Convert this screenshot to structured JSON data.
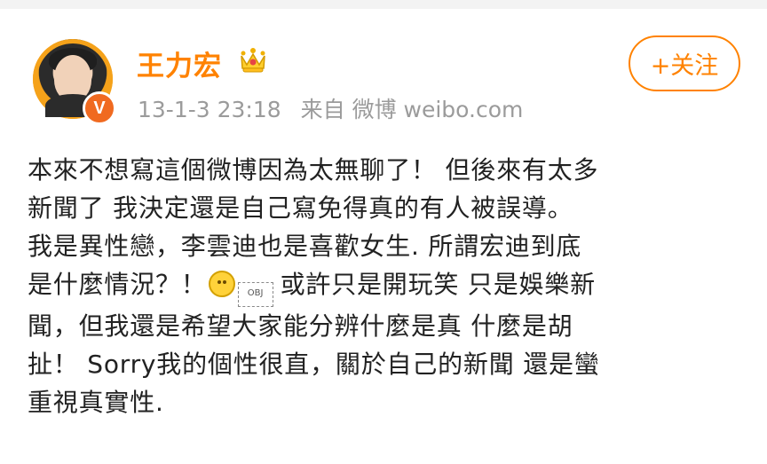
{
  "profile": {
    "username": "王力宏",
    "avatar_icon": "avatar-icon",
    "verified_badge": "V",
    "crown_icon": "crown-icon"
  },
  "meta": {
    "timestamp": "13-1-3 23:18",
    "source": "来自 微博 weibo.com"
  },
  "follow": {
    "label": "+关注"
  },
  "post": {
    "lines": [
      "本來不想寫這個微博因為太無聊了！ 但後來有太多",
      "新聞了 我決定還是自己寫免得真的有人被誤導。",
      "我是異性戀，李雲迪也是喜歡女生. 所謂宏迪到底",
      "是什麼情況？！",
      "或許只是開玩笑 只是娛樂新",
      "聞，但我還是希望大家能分辨什麼是真 什麼是胡",
      "扯！ Sorry我的個性很直，關於自己的新聞 還是蠻",
      "重視真實性."
    ],
    "obj_label": "OBJ"
  },
  "colors": {
    "accent": "#ff8200",
    "meta_text": "#9b9b9b",
    "body_text": "#222222",
    "badge": "#f06a20"
  }
}
